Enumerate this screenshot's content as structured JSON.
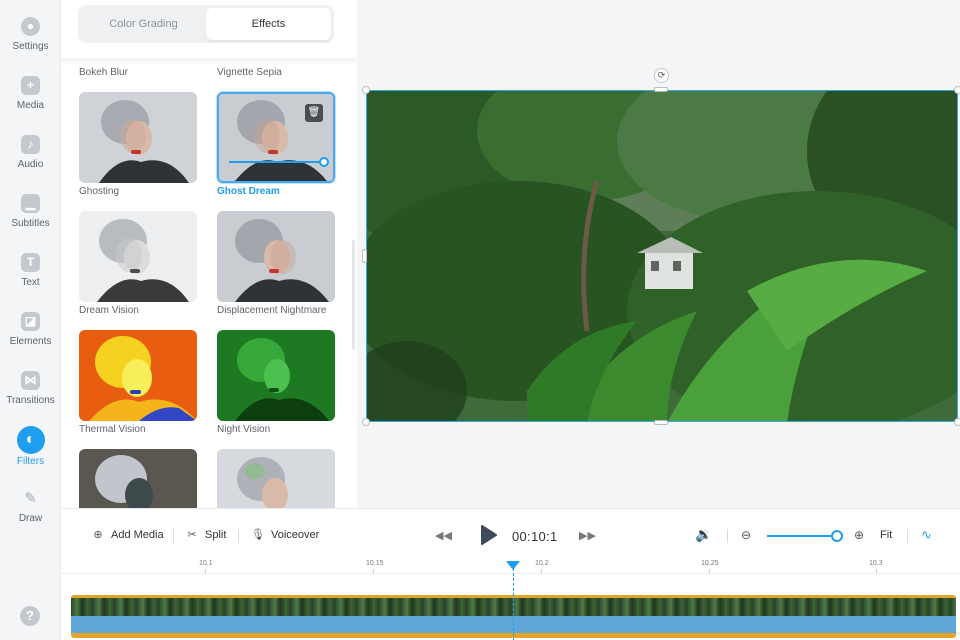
{
  "sidebar": {
    "items": [
      {
        "label": "Settings",
        "icon": "settings-icon"
      },
      {
        "label": "Media",
        "icon": "media-icon"
      },
      {
        "label": "Audio",
        "icon": "audio-icon"
      },
      {
        "label": "Subtitles",
        "icon": "subtitles-icon"
      },
      {
        "label": "Text",
        "icon": "text-icon"
      },
      {
        "label": "Elements",
        "icon": "elements-icon"
      },
      {
        "label": "Transitions",
        "icon": "transitions-icon"
      },
      {
        "label": "Filters",
        "icon": "filters-icon",
        "active": true
      },
      {
        "label": "Draw",
        "icon": "draw-icon"
      }
    ],
    "help_icon": "?"
  },
  "panel": {
    "tabs": [
      {
        "label": "Color Grading"
      },
      {
        "label": "Effects",
        "active": true
      }
    ],
    "top_row": [
      "Bokeh Blur",
      "Vignette Sepia"
    ],
    "filters": [
      {
        "label": "Ghosting"
      },
      {
        "label": "Ghost Dream",
        "selected": true,
        "intensity": 1.0
      },
      {
        "label": "Dream Vision"
      },
      {
        "label": "Displacement Nightmare"
      },
      {
        "label": "Thermal Vision"
      },
      {
        "label": "Night Vision"
      },
      {
        "label": ""
      },
      {
        "label": ""
      }
    ]
  },
  "toolbar": {
    "add_media": "Add Media",
    "split": "Split",
    "voiceover": "Voiceover",
    "time": "00:10:1",
    "fit": "Fit",
    "zoom_level": 1.0
  },
  "ruler": {
    "labels": [
      "10.1",
      "10.15",
      "10.2",
      "10.25",
      "10.3"
    ]
  },
  "colors": {
    "accent": "#1e9ef0",
    "track_border": "#e2a42b",
    "track_audio": "#5ea7d8"
  }
}
